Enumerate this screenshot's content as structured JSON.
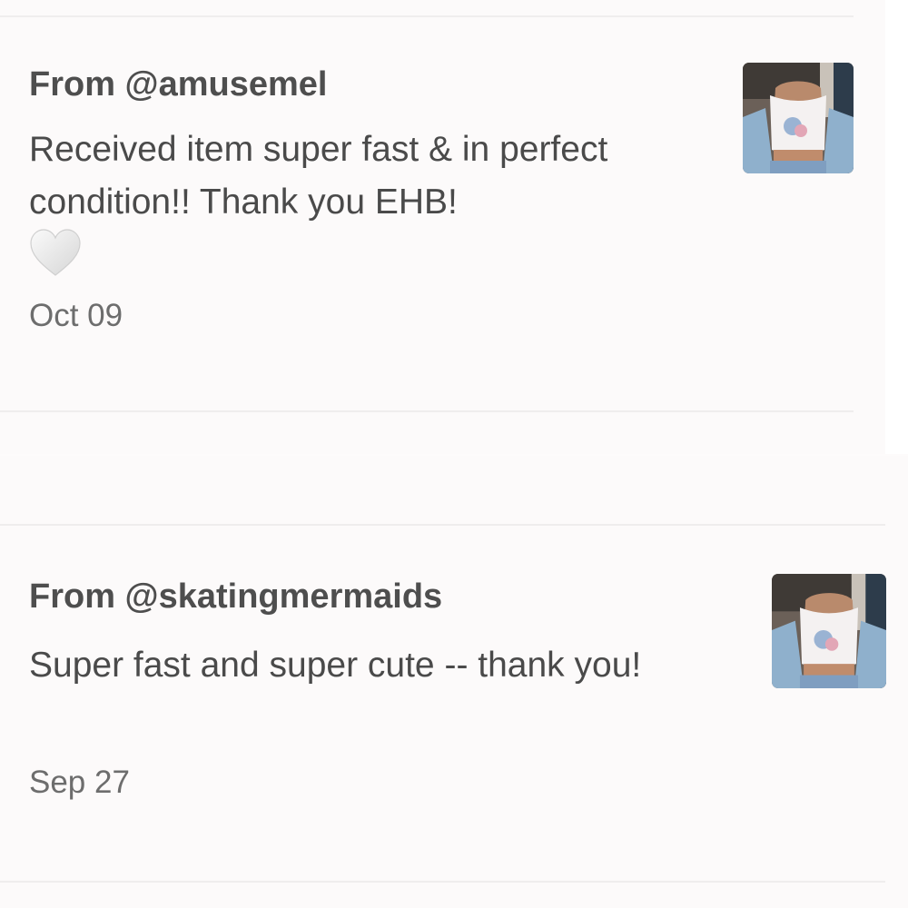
{
  "reviews": [
    {
      "from": "From @amusemel",
      "text": "Received item super fast & in perfect condition!! Thank you EHB!",
      "emoji": "white-heart",
      "date": "Oct 09"
    },
    {
      "from": "From @skatingmermaids",
      "text": "Super fast and super cute -- thank you!",
      "date": "Sep 27"
    }
  ],
  "colors": {
    "background": "#fcfafa",
    "text": "#4a4a4a",
    "date": "#6d6d6d",
    "divider": "#efeded"
  },
  "icons": {
    "heart": "white-heart-icon",
    "thumbnail": "product-photo-thumbnail"
  }
}
